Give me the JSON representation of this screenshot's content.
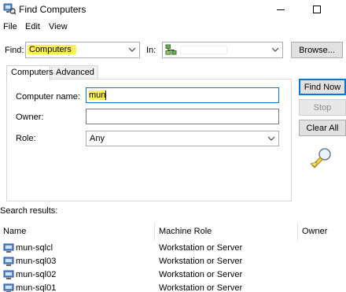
{
  "window": {
    "title": "Find Computers"
  },
  "menu": [
    "File",
    "Edit",
    "View"
  ],
  "find": {
    "find_label": "Find:",
    "find_value": "Computers",
    "in_label": "In:",
    "browse_label": "Browse..."
  },
  "tabs": [
    "Computers",
    "Advanced"
  ],
  "form": {
    "computer_name_label": "Computer name:",
    "computer_name_value": "mun",
    "owner_label": "Owner:",
    "owner_value": "",
    "role_label": "Role:",
    "role_value": "Any"
  },
  "actions": {
    "find_now": "Find Now",
    "stop": "Stop",
    "clear_all": "Clear All"
  },
  "results": {
    "label": "Search results:",
    "columns": [
      "Name",
      "Machine Role",
      "Owner"
    ],
    "rows": [
      {
        "name": "mun-sqlcl",
        "role": "Workstation or Server",
        "owner": ""
      },
      {
        "name": "mun-sql03",
        "role": "Workstation or Server",
        "owner": ""
      },
      {
        "name": "mun-sql02",
        "role": "Workstation or Server",
        "owner": ""
      },
      {
        "name": "mun-sql01",
        "role": "Workstation or Server",
        "owner": ""
      }
    ]
  },
  "colors": {
    "highlight": "#fdf24f",
    "focus": "#0078d7",
    "button": "#e1e1e1"
  },
  "icons": [
    "find-computers-icon",
    "minimize-icon",
    "maximize-icon",
    "chevron-down-icon",
    "domain-icon",
    "search-flashlight-icon",
    "computer-icon"
  ]
}
